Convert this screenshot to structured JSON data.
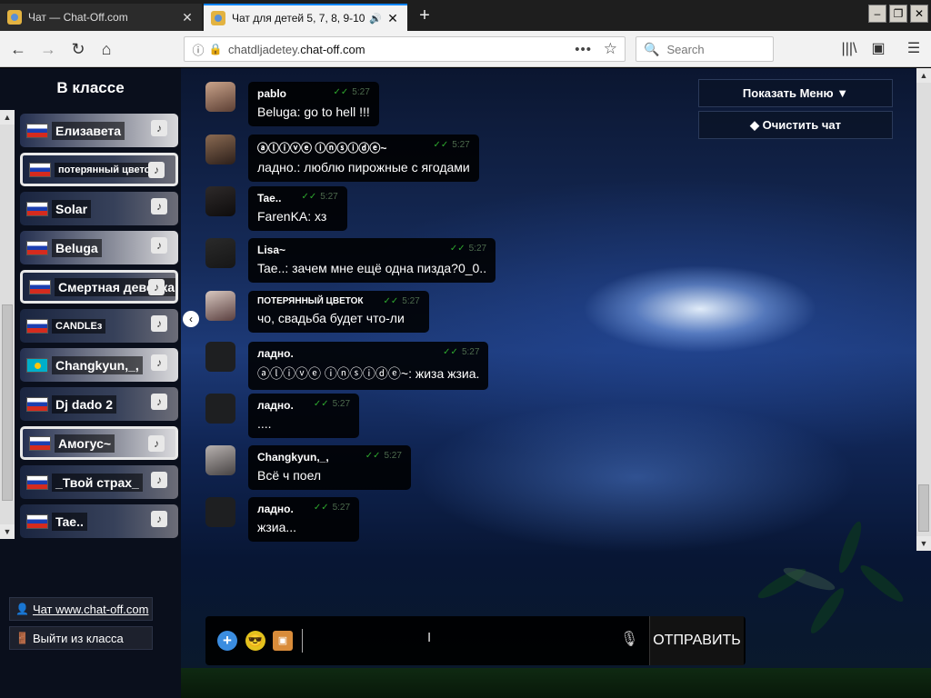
{
  "browser": {
    "tabs": [
      {
        "title": "Чат — Chat-Off.com",
        "close": "✕"
      },
      {
        "title": "Чат для детей 5, 7, 8, 9-10,",
        "close": "✕",
        "audio": "🔊"
      }
    ],
    "new_tab": "+",
    "window_controls": [
      "–",
      "❐",
      "✕"
    ],
    "nav": {
      "back": "←",
      "forward": "→",
      "reload": "↻",
      "home": "⌂"
    },
    "url": {
      "prefix": "chatdljadetey.",
      "host": "chat-off.com",
      "info": "ⓘ",
      "lock": "🔒",
      "dots": "•••",
      "star": "☆"
    },
    "search": {
      "icon": "🔍",
      "placeholder": "Search"
    },
    "tools": {
      "library": "|||\\",
      "sidebar": "▣",
      "menu": "☰"
    }
  },
  "sidebar": {
    "title": "В классе",
    "scroll_up": "▲",
    "scroll_down": "▼",
    "collapse": "‹",
    "users": [
      {
        "name": "Елизавета",
        "flag": "ru"
      },
      {
        "name": "потерянный цветок",
        "flag": "ru",
        "small": true
      },
      {
        "name": "Solar",
        "flag": "ru"
      },
      {
        "name": "Beluga",
        "flag": "ru"
      },
      {
        "name": "Смертная девочка",
        "flag": "ru"
      },
      {
        "name": "CANDLEз",
        "flag": "ru",
        "small": true
      },
      {
        "name": "Changkyun,_,",
        "flag": "kz"
      },
      {
        "name": "Dj dado 2",
        "flag": "ru"
      },
      {
        "name": "Амогус~",
        "flag": "ru"
      },
      {
        "name": "_Твой страх_",
        "flag": "ru"
      },
      {
        "name": "Tae..",
        "flag": "ru"
      }
    ],
    "note_icon": "♪",
    "links": {
      "chat": {
        "icon": "👤",
        "label": "Чат www.chat-off.com"
      },
      "exit": {
        "icon": "🚪",
        "label": "Выйти из класса"
      }
    }
  },
  "messages": [
    {
      "author": "pablo",
      "time": "5:27",
      "text": "Beluga: go to hell !!!",
      "avatar": "a1"
    },
    {
      "author": "ⓐⓛⓘⓥⓔ ⓘⓝⓢⓘⓓⓔ~",
      "time": "5:27",
      "text": "ладно.: люблю пирожные с ягодами",
      "avatar": "a2"
    },
    {
      "author": "Tae..",
      "time": "5:27",
      "text": "FarenKA: хз",
      "avatar": "a3"
    },
    {
      "author": "Lisa~",
      "time": "5:27",
      "text": "Tae..: зачем мне ещё одна пизда?0_0..",
      "avatar": "a4"
    },
    {
      "author": "ПОТЕРЯННЫЙ ЦВЕТОК",
      "time": "5:27",
      "text": "чо, свадьба будет что-ли",
      "avatar": "a5"
    },
    {
      "author": "ладно.",
      "time": "5:27",
      "text": "ⓐⓛⓘⓥⓔ ⓘⓝⓢⓘⓓⓔ~: жиза жзиа.",
      "avatar": "a6"
    },
    {
      "author": "ладно.",
      "time": "5:27",
      "text": "....",
      "avatar": "a6"
    },
    {
      "author": "Changkyun,_,",
      "time": "5:27",
      "text": "Всё ч поел",
      "avatar": "a7"
    },
    {
      "author": "ладно.",
      "time": "5:27",
      "text": "жзиа...",
      "avatar": "a6"
    }
  ],
  "check_marks": "✓✓",
  "menu": {
    "show": "Показать Меню ▼",
    "clear": "Очистить чат",
    "clear_icon": "◆"
  },
  "main_scroll": {
    "up": "▲",
    "down": "▼"
  },
  "composer": {
    "add_icon": "+",
    "emoji_icon": "😎",
    "image_icon": "▣",
    "input_value": "",
    "cursor": "I",
    "mic_icon": "🎙",
    "send_label": "ОТПРАВИТЬ"
  }
}
